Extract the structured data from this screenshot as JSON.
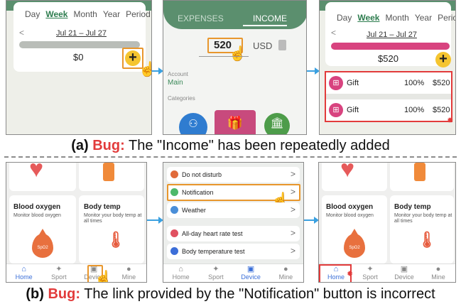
{
  "p1": {
    "tabs": [
      "Day",
      "Week",
      "Month",
      "Year",
      "Period"
    ],
    "range": "Jul 21 – Jul 27",
    "amount": "$0",
    "plus": "+",
    "prev": "<"
  },
  "p2": {
    "tab_expenses": "EXPENSES",
    "tab_income": "INCOME",
    "amount": "520",
    "currency": "USD",
    "account_label": "Account",
    "account_value": "Main",
    "categories_label": "Categories"
  },
  "p3": {
    "tabs": [
      "Day",
      "Week",
      "Month",
      "Year",
      "Period"
    ],
    "range": "Jul 21 – Jul 27",
    "amount": "$520",
    "plus": "+",
    "prev": "<",
    "rows": [
      {
        "name": "Gift",
        "pct": "100%",
        "amt": "$520"
      },
      {
        "name": "Gift",
        "pct": "100%",
        "amt": "$520"
      }
    ]
  },
  "caption_a": {
    "prefix": "(a)",
    "bug": "Bug:",
    "text": "The \"Income\" has been repeatedly added"
  },
  "p4": {
    "card1_title": "Blood oxygen",
    "card1_sub": "Monitor blood oxygen",
    "card1_drop": "SpO2",
    "card2_title": "Body temp",
    "card2_sub": "Monitor your body temp at all times"
  },
  "nav": [
    "Home",
    "Sport",
    "Device",
    "Mine"
  ],
  "p5": {
    "items": [
      "Do not disturb",
      "Notification",
      "Weather",
      "All-day heart rate test",
      "Body temperature test"
    ],
    "chev": ">"
  },
  "p6": {
    "card1_title": "Blood oxygen",
    "card1_sub": "Monitor blood oxygen",
    "card1_drop": "SpO2",
    "card2_title": "Body temp",
    "card2_sub": "Monitor your body temp at all times"
  },
  "caption_b": {
    "prefix": "(b)",
    "bug": "Bug:",
    "text": "The link provided by the \"Notification\" button is incorrect"
  },
  "colors": {
    "green": "#5b8f6e",
    "accent": "#f5c530",
    "pink": "#d8437f",
    "highlight": "#e8962c",
    "bug": "#e23b3b",
    "arrow": "#3aa0e0"
  },
  "icons": {
    "hand": "pointer-hand-icon",
    "bug": "bug-icon"
  }
}
